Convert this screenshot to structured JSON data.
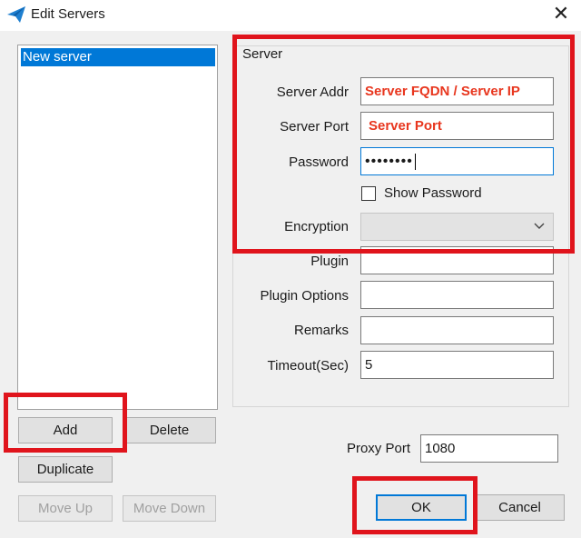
{
  "window": {
    "title": "Edit Servers",
    "close_glyph": "✕",
    "app_icon": "paper-plane-icon"
  },
  "server_list": {
    "items": [
      {
        "label": "New server",
        "selected": true
      }
    ]
  },
  "buttons": {
    "add": "Add",
    "delete": "Delete",
    "duplicate": "Duplicate",
    "move_up": "Move Up",
    "move_down": "Move Down",
    "ok": "OK",
    "cancel": "Cancel"
  },
  "server_group": {
    "legend": "Server",
    "server_addr": {
      "label": "Server Addr",
      "value": "Server FQDN / Server IP"
    },
    "server_port": {
      "label": "Server Port",
      "value": "Server Port"
    },
    "password": {
      "label": "Password",
      "value": "••••••••"
    },
    "show_password": {
      "label": "Show Password",
      "checked": false
    },
    "encryption": {
      "label": "Encryption",
      "value": ""
    },
    "plugin": {
      "label": "Plugin",
      "value": ""
    },
    "plugin_options": {
      "label": "Plugin Options",
      "value": ""
    },
    "remarks": {
      "label": "Remarks",
      "value": ""
    },
    "timeout": {
      "label": "Timeout(Sec)",
      "value": "5"
    }
  },
  "proxy_port": {
    "label": "Proxy Port",
    "value": "1080"
  },
  "colors": {
    "accent": "#0078d7",
    "annotation_red": "#e0141c",
    "highlight_text": "#e8361e"
  }
}
